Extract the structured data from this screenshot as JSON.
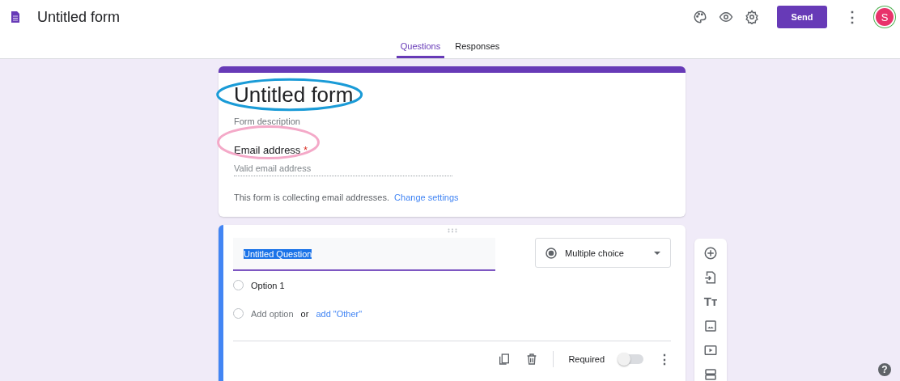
{
  "app": {
    "title": "Untitled form",
    "send": "Send",
    "avatar": "S",
    "more": "⋮"
  },
  "tabs": [
    {
      "label": "Questions",
      "selected": true
    },
    {
      "label": "Responses",
      "selected": false
    }
  ],
  "form": {
    "title": "Untitled form",
    "description_placeholder": "Form description",
    "email_label": "Email address",
    "required_mark": "*",
    "email_placeholder": "Valid email address",
    "notice": "This form is collecting email addresses.",
    "notice_link": "Change settings"
  },
  "annotations": [
    {
      "kind": "ellipse",
      "color": "#1a9bd7"
    },
    {
      "kind": "ellipse",
      "color": "#f4a9c8"
    }
  ],
  "question": {
    "title": "Untitled Question",
    "title_selected": true,
    "type": "Multiple choice",
    "options": [
      {
        "label": "Option 1",
        "checked": false
      }
    ],
    "add_option_checked": false,
    "add_option": "Add option",
    "or": "or",
    "add_other": "add \"Other\"",
    "required_label": "Required",
    "required": false,
    "more": "⋮"
  },
  "toolbar": {
    "title_icon": "Tт"
  },
  "help": "?"
}
